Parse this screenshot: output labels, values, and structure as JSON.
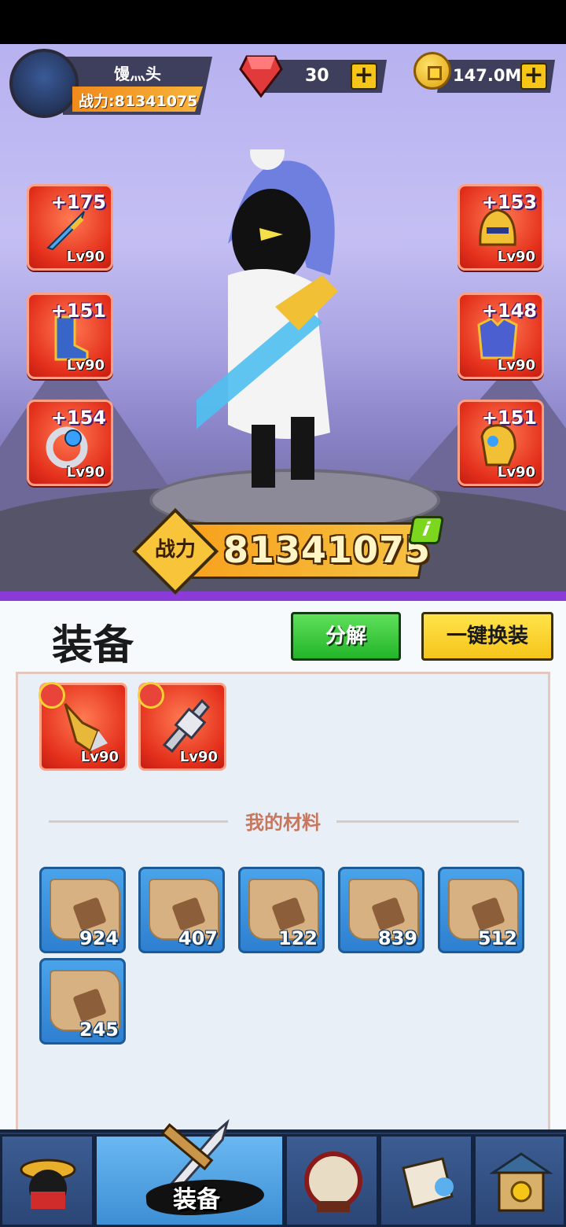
{
  "player": {
    "name": "馒灬头",
    "power_label": "战力:81341075"
  },
  "resources": {
    "gems": "30",
    "gold": "147.0M"
  },
  "equipped": {
    "left": [
      {
        "plus": "+175",
        "level": "Lv90",
        "icon": "sword-icon"
      },
      {
        "plus": "+151",
        "level": "Lv90",
        "icon": "boots-icon"
      },
      {
        "plus": "+154",
        "level": "Lv90",
        "icon": "ring-icon"
      }
    ],
    "right": [
      {
        "plus": "+153",
        "level": "Lv90",
        "icon": "helmet-icon"
      },
      {
        "plus": "+148",
        "level": "Lv90",
        "icon": "armor-icon"
      },
      {
        "plus": "+151",
        "level": "Lv90",
        "icon": "gauntlet-icon"
      }
    ]
  },
  "power_banner": {
    "label": "战力",
    "value": "81341075",
    "info": "i"
  },
  "panel": {
    "title": "装备",
    "decompose_label": "分解",
    "auto_equip_label": "一键换装"
  },
  "inventory": [
    {
      "level": "Lv90",
      "icon": "drill-weapon-icon"
    },
    {
      "level": "Lv90",
      "icon": "mace-weapon-icon"
    }
  ],
  "materials": {
    "label": "我的材料",
    "items": [
      {
        "count": "924",
        "icon": "sword-scroll-icon"
      },
      {
        "count": "407",
        "icon": "armor-scroll-icon"
      },
      {
        "count": "122",
        "icon": "ring-scroll-icon"
      },
      {
        "count": "839",
        "icon": "boots-scroll-icon"
      },
      {
        "count": "512",
        "icon": "gauntlet-scroll-icon"
      },
      {
        "count": "245",
        "icon": "helmet-scroll-icon"
      }
    ]
  },
  "nav": {
    "active_label": "装备"
  }
}
